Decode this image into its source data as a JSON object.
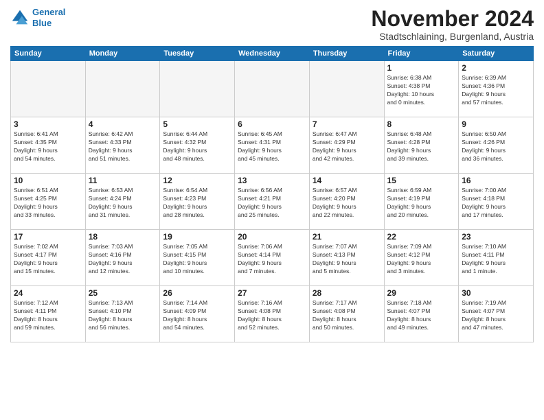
{
  "logo": {
    "line1": "General",
    "line2": "Blue"
  },
  "title": "November 2024",
  "subtitle": "Stadtschlaining, Burgenland, Austria",
  "headers": [
    "Sunday",
    "Monday",
    "Tuesday",
    "Wednesday",
    "Thursday",
    "Friday",
    "Saturday"
  ],
  "weeks": [
    [
      {
        "day": "",
        "info": ""
      },
      {
        "day": "",
        "info": ""
      },
      {
        "day": "",
        "info": ""
      },
      {
        "day": "",
        "info": ""
      },
      {
        "day": "",
        "info": ""
      },
      {
        "day": "1",
        "info": "Sunrise: 6:38 AM\nSunset: 4:38 PM\nDaylight: 10 hours\nand 0 minutes."
      },
      {
        "day": "2",
        "info": "Sunrise: 6:39 AM\nSunset: 4:36 PM\nDaylight: 9 hours\nand 57 minutes."
      }
    ],
    [
      {
        "day": "3",
        "info": "Sunrise: 6:41 AM\nSunset: 4:35 PM\nDaylight: 9 hours\nand 54 minutes."
      },
      {
        "day": "4",
        "info": "Sunrise: 6:42 AM\nSunset: 4:33 PM\nDaylight: 9 hours\nand 51 minutes."
      },
      {
        "day": "5",
        "info": "Sunrise: 6:44 AM\nSunset: 4:32 PM\nDaylight: 9 hours\nand 48 minutes."
      },
      {
        "day": "6",
        "info": "Sunrise: 6:45 AM\nSunset: 4:31 PM\nDaylight: 9 hours\nand 45 minutes."
      },
      {
        "day": "7",
        "info": "Sunrise: 6:47 AM\nSunset: 4:29 PM\nDaylight: 9 hours\nand 42 minutes."
      },
      {
        "day": "8",
        "info": "Sunrise: 6:48 AM\nSunset: 4:28 PM\nDaylight: 9 hours\nand 39 minutes."
      },
      {
        "day": "9",
        "info": "Sunrise: 6:50 AM\nSunset: 4:26 PM\nDaylight: 9 hours\nand 36 minutes."
      }
    ],
    [
      {
        "day": "10",
        "info": "Sunrise: 6:51 AM\nSunset: 4:25 PM\nDaylight: 9 hours\nand 33 minutes."
      },
      {
        "day": "11",
        "info": "Sunrise: 6:53 AM\nSunset: 4:24 PM\nDaylight: 9 hours\nand 31 minutes."
      },
      {
        "day": "12",
        "info": "Sunrise: 6:54 AM\nSunset: 4:23 PM\nDaylight: 9 hours\nand 28 minutes."
      },
      {
        "day": "13",
        "info": "Sunrise: 6:56 AM\nSunset: 4:21 PM\nDaylight: 9 hours\nand 25 minutes."
      },
      {
        "day": "14",
        "info": "Sunrise: 6:57 AM\nSunset: 4:20 PM\nDaylight: 9 hours\nand 22 minutes."
      },
      {
        "day": "15",
        "info": "Sunrise: 6:59 AM\nSunset: 4:19 PM\nDaylight: 9 hours\nand 20 minutes."
      },
      {
        "day": "16",
        "info": "Sunrise: 7:00 AM\nSunset: 4:18 PM\nDaylight: 9 hours\nand 17 minutes."
      }
    ],
    [
      {
        "day": "17",
        "info": "Sunrise: 7:02 AM\nSunset: 4:17 PM\nDaylight: 9 hours\nand 15 minutes."
      },
      {
        "day": "18",
        "info": "Sunrise: 7:03 AM\nSunset: 4:16 PM\nDaylight: 9 hours\nand 12 minutes."
      },
      {
        "day": "19",
        "info": "Sunrise: 7:05 AM\nSunset: 4:15 PM\nDaylight: 9 hours\nand 10 minutes."
      },
      {
        "day": "20",
        "info": "Sunrise: 7:06 AM\nSunset: 4:14 PM\nDaylight: 9 hours\nand 7 minutes."
      },
      {
        "day": "21",
        "info": "Sunrise: 7:07 AM\nSunset: 4:13 PM\nDaylight: 9 hours\nand 5 minutes."
      },
      {
        "day": "22",
        "info": "Sunrise: 7:09 AM\nSunset: 4:12 PM\nDaylight: 9 hours\nand 3 minutes."
      },
      {
        "day": "23",
        "info": "Sunrise: 7:10 AM\nSunset: 4:11 PM\nDaylight: 9 hours\nand 1 minute."
      }
    ],
    [
      {
        "day": "24",
        "info": "Sunrise: 7:12 AM\nSunset: 4:11 PM\nDaylight: 8 hours\nand 59 minutes."
      },
      {
        "day": "25",
        "info": "Sunrise: 7:13 AM\nSunset: 4:10 PM\nDaylight: 8 hours\nand 56 minutes."
      },
      {
        "day": "26",
        "info": "Sunrise: 7:14 AM\nSunset: 4:09 PM\nDaylight: 8 hours\nand 54 minutes."
      },
      {
        "day": "27",
        "info": "Sunrise: 7:16 AM\nSunset: 4:08 PM\nDaylight: 8 hours\nand 52 minutes."
      },
      {
        "day": "28",
        "info": "Sunrise: 7:17 AM\nSunset: 4:08 PM\nDaylight: 8 hours\nand 50 minutes."
      },
      {
        "day": "29",
        "info": "Sunrise: 7:18 AM\nSunset: 4:07 PM\nDaylight: 8 hours\nand 49 minutes."
      },
      {
        "day": "30",
        "info": "Sunrise: 7:19 AM\nSunset: 4:07 PM\nDaylight: 8 hours\nand 47 minutes."
      }
    ]
  ]
}
